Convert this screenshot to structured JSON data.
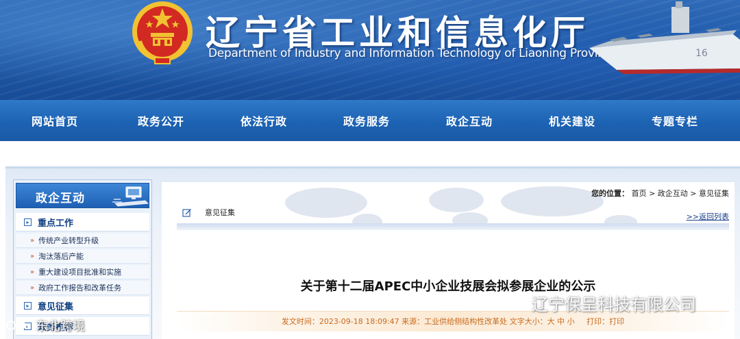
{
  "banner": {
    "title_cn": "辽宁省工业和信息化厅",
    "title_en": "Department of Industry and Information Technology of Liaoning Province",
    "ship_hull_number": "16"
  },
  "nav": {
    "items": [
      "网站首页",
      "政务公开",
      "依法行政",
      "政务服务",
      "政企互动",
      "机关建设",
      "专题专栏"
    ]
  },
  "sidebar": {
    "header": "政企互动",
    "categories": [
      {
        "label": "重点工作",
        "items": [
          "传统产业转型升级",
          "淘汰落后产能",
          "重大建设项目批准和实施",
          "政府工作报告和改革任务"
        ]
      },
      {
        "label": "意见征集",
        "items": []
      },
      {
        "label": "政务推荐",
        "items": []
      }
    ]
  },
  "main": {
    "breadcrumb": {
      "label": "您的位置：",
      "items": [
        "首页",
        "政企互动",
        "意见征集"
      ],
      "separator": " > "
    },
    "section_title": "意见征集",
    "back_link": ">>返回列表",
    "article_title": "关于第十二届APEC中小企业技展会拟参展企业的公示",
    "meta": {
      "date_label": "发文时间：",
      "date": "2023-09-18 18:09:47",
      "source_label": "来源：",
      "source": "工业供给侧结构性改革处",
      "font_label": "文字大小：",
      "font_sizes": [
        "大",
        "中",
        "小"
      ],
      "print_label": "打印：",
      "print_link": "打印"
    }
  },
  "watermarks": {
    "right": "辽宁保呈科技有限公司",
    "left": "东北跨境"
  },
  "colors": {
    "nav_blue": "#1d63b3",
    "banner_blue": "#1f5aa8",
    "meta_orange": "#c86a1e",
    "emblem_red": "#d22a22",
    "emblem_gold": "#f1c232"
  }
}
